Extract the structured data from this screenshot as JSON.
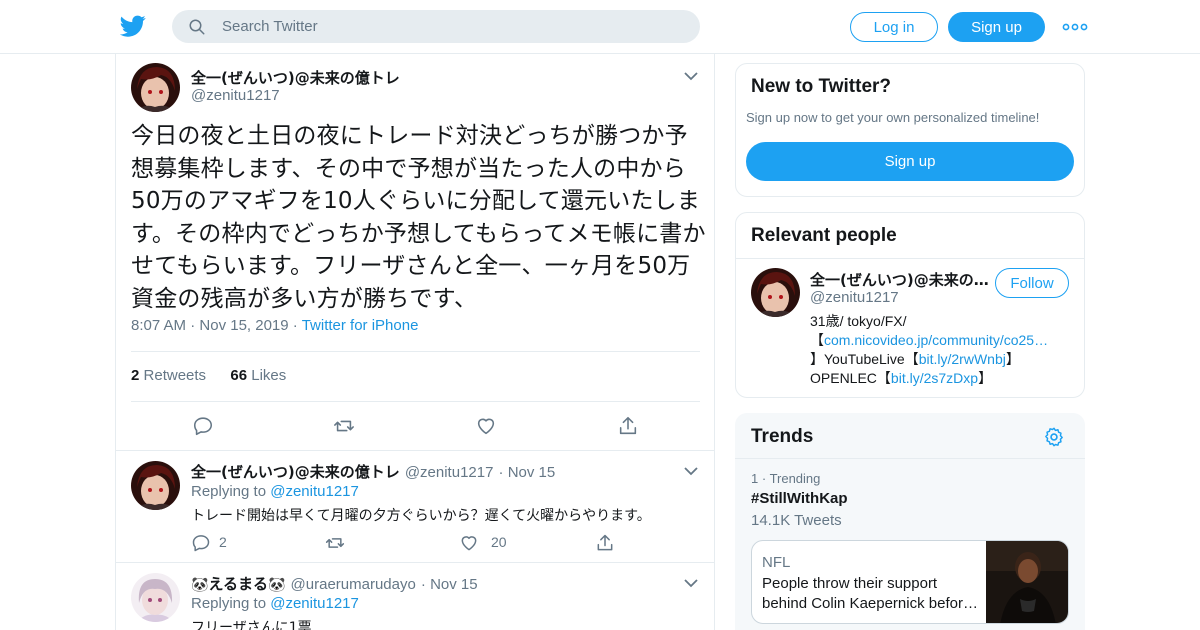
{
  "topbar": {
    "search_placeholder": "Search Twitter",
    "login_label": "Log in",
    "signup_label": "Sign up"
  },
  "tweet": {
    "author_name": "全一(ぜんいつ)@未来の億トレ",
    "author_handle": "@zenitu1217",
    "text": "今日の夜と土日の夜にトレード対決どっちが勝つか予想募集枠します、その中で予想が当たった人の中から50万のアマギフを10人ぐらいに分配して還元いたします。その枠内でどっちか予想してもらってメモ帳に書かせてもらいます。フリーザさんと全一、一ヶ月を50万資金の残高が多い方が勝ちです、",
    "time": "8:07 AM",
    "date": "Nov 15, 2019",
    "source": "Twitter for iPhone",
    "retweets_count": "2",
    "retweets_label": "Retweets",
    "likes_count": "66",
    "likes_label": "Likes"
  },
  "replies": [
    {
      "author_name": "全一(ぜんいつ)@未来の億トレ",
      "author_handle": "@zenitu1217",
      "date": "Nov 15",
      "replying_to_prefix": "Replying to",
      "replying_to": "@zenitu1217",
      "text": "トレード開始は早くて月曜の夕方ぐらいから？遅くて火曜からやります。",
      "reply_count": "2",
      "like_count": "20"
    },
    {
      "author_name": "えるまる",
      "author_handle": "@uraerumarudayo",
      "date": "Nov 15",
      "replying_to_prefix": "Replying to",
      "replying_to": "@zenitu1217",
      "text": "フリーザさんに1票"
    }
  ],
  "new_to_twitter": {
    "title": "New to Twitter?",
    "subtitle": "Sign up now to get your own personalized timeline!",
    "signup_label": "Sign up"
  },
  "relevant_people": {
    "title": "Relevant people",
    "name": "全一(ぜんいつ)@未来の…",
    "handle": "@zenitu1217",
    "follow_label": "Follow",
    "bio_line1": "31歳/ tokyo/FX/",
    "bio_bracket_open": "【",
    "bio_link1": "com.nicovideo.jp/community/co25…",
    "bio_line3_prefix": "】YouTubeLive【",
    "bio_link2": "bit.ly/2rwWnbj",
    "bio_bracket_close": "】",
    "bio_line4_prefix": "OPENLEC【",
    "bio_link3": "bit.ly/2s7zDxp",
    "bio_line4_suffix": "】"
  },
  "trends": {
    "title": "Trends",
    "items": [
      {
        "rank": "1",
        "label": "Trending",
        "hashtag": "#StillWithKap",
        "tweets": "14.1K Tweets"
      }
    ],
    "news": {
      "category": "NFL",
      "headline": "People throw their support behind Colin Kaepernick befor…"
    }
  },
  "colors": {
    "brand": "#1da1f2",
    "link": "#1b95e0",
    "muted": "#657786",
    "border": "#e6ecf0"
  }
}
